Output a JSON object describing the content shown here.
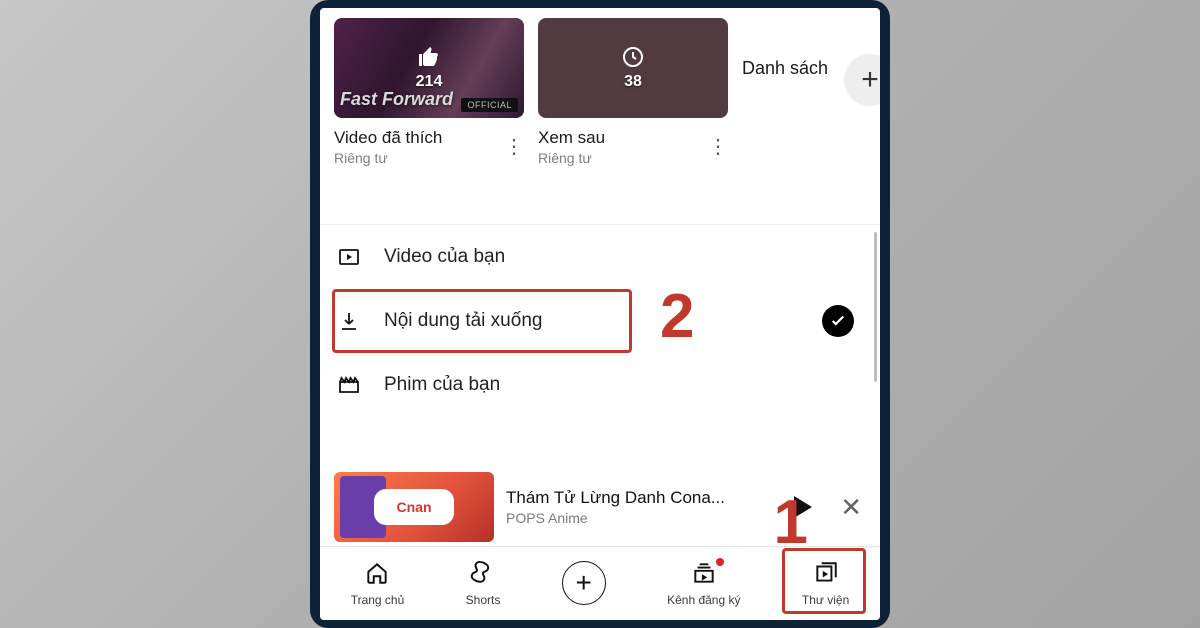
{
  "playlists": {
    "liked": {
      "title": "Video đã thích",
      "privacy": "Riêng tư",
      "count": "214",
      "overlay": "Fast Forward",
      "yg": "OFFICIAL"
    },
    "later": {
      "title": "Xem sau",
      "privacy": "Riêng tư",
      "count": "38"
    },
    "partial": {
      "title": "Danh sách"
    }
  },
  "rows": {
    "yourVideos": "Video của bạn",
    "downloads": "Nội dung tải xuống",
    "yourMovies": "Phim của bạn"
  },
  "miniplayer": {
    "title": "Thám Tử Lừng Danh Cona...",
    "channel": "POPS Anime",
    "logo": "Cnan"
  },
  "nav": {
    "home": "Trang chủ",
    "shorts": "Shorts",
    "subs": "Kênh đăng ký",
    "library": "Thư viện"
  },
  "annotations": {
    "step1": "1",
    "step2": "2"
  }
}
